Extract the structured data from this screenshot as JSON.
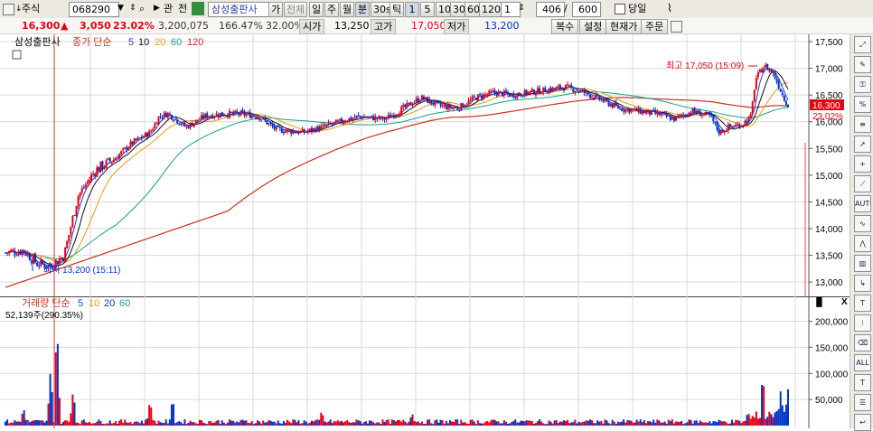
{
  "toolbar": {
    "market_type": "주식",
    "code": "068290",
    "related_label": "관",
    "prev_label": "전",
    "stock_name": "삼성출판사",
    "ga_label": "가",
    "all_label": "전체",
    "periods": [
      "일",
      "주",
      "월",
      "분",
      "30s",
      "틱"
    ],
    "intervals": [
      "1",
      "5",
      "10",
      "30",
      "60",
      "120"
    ],
    "multiplier": "1",
    "count": "406",
    "total": "600",
    "today_label": "당일"
  },
  "quote": {
    "price": "16,300",
    "change_arrow": "▲",
    "change": "3,050",
    "change_pct": "23.02%",
    "volume": "3,200,075",
    "volume_ratio": "166.47%",
    "turnover": "32.00%",
    "open_label": "시가",
    "open": "13,250",
    "high_label": "고가",
    "high": "17,050",
    "low_label": "저가",
    "low": "13,200",
    "buttons": [
      "복수",
      "설정",
      "현재가",
      "주문"
    ]
  },
  "price_panel": {
    "stock_name": "삼성출판사",
    "legend_label": "종가 단순",
    "ma_periods": [
      "5",
      "10",
      "20",
      "60",
      "120"
    ],
    "high_annotation": "최고 17,050 (15:09)",
    "low_annotation": "최저 13,200 (15:11)",
    "last_price_tag": "16,300",
    "last_pct_tag": "23.02%",
    "y_ticks": [
      "17,500",
      "17,000",
      "16,500",
      "16,000",
      "15,500",
      "15,000",
      "14,500",
      "14,000",
      "13,500",
      "13,000"
    ]
  },
  "volume_panel": {
    "legend_label": "거래량 단순",
    "ma_periods": [
      "5",
      "10",
      "20",
      "60"
    ],
    "current": "52,139주(290.35%)",
    "y_ticks": [
      "200,000",
      "150,000",
      "100,000",
      "50,000"
    ]
  },
  "colors": {
    "up": "#e60012",
    "down": "#0033cc",
    "ma5": "#1f3fd7",
    "ma10": "#111111",
    "ma20": "#e89a16",
    "ma60": "#17a087",
    "ma120": "#c8321e"
  },
  "chart_data": {
    "type": "line",
    "title": "",
    "series_kind": "candlestick_close",
    "ylim": [
      12800,
      17500
    ],
    "key_points": [
      {
        "x": 1,
        "close": 13550
      },
      {
        "x": 20,
        "close": 13600
      },
      {
        "x": 35,
        "close": 13350
      },
      {
        "x": 50,
        "close": 13300
      },
      {
        "x": 65,
        "close": 13500
      },
      {
        "x": 80,
        "close": 14600
      },
      {
        "x": 100,
        "close": 15100
      },
      {
        "x": 120,
        "close": 15300
      },
      {
        "x": 140,
        "close": 15600
      },
      {
        "x": 160,
        "close": 15800
      },
      {
        "x": 170,
        "close": 16100
      },
      {
        "x": 180,
        "close": 16150
      },
      {
        "x": 200,
        "close": 15900
      },
      {
        "x": 220,
        "close": 16100
      },
      {
        "x": 240,
        "close": 16150
      },
      {
        "x": 260,
        "close": 16150
      },
      {
        "x": 280,
        "close": 16100
      },
      {
        "x": 300,
        "close": 15850
      },
      {
        "x": 330,
        "close": 15800
      },
      {
        "x": 360,
        "close": 15950
      },
      {
        "x": 390,
        "close": 16100
      },
      {
        "x": 420,
        "close": 16050
      },
      {
        "x": 445,
        "close": 16300
      },
      {
        "x": 460,
        "close": 16450
      },
      {
        "x": 480,
        "close": 16300
      },
      {
        "x": 500,
        "close": 16250
      },
      {
        "x": 520,
        "close": 16450
      },
      {
        "x": 540,
        "close": 16550
      },
      {
        "x": 560,
        "close": 16500
      },
      {
        "x": 580,
        "close": 16550
      },
      {
        "x": 600,
        "close": 16600
      },
      {
        "x": 620,
        "close": 16650
      },
      {
        "x": 640,
        "close": 16550
      },
      {
        "x": 660,
        "close": 16400
      },
      {
        "x": 680,
        "close": 16250
      },
      {
        "x": 700,
        "close": 16200
      },
      {
        "x": 720,
        "close": 16150
      },
      {
        "x": 740,
        "close": 16050
      },
      {
        "x": 760,
        "close": 16200
      },
      {
        "x": 780,
        "close": 16100
      },
      {
        "x": 790,
        "close": 15800
      },
      {
        "x": 800,
        "close": 15900
      },
      {
        "x": 815,
        "close": 15950
      },
      {
        "x": 825,
        "close": 16100
      },
      {
        "x": 830,
        "close": 16800
      },
      {
        "x": 840,
        "close": 17050
      },
      {
        "x": 850,
        "close": 16900
      },
      {
        "x": 860,
        "close": 16500
      },
      {
        "x": 866,
        "close": 16300
      }
    ],
    "volume_key_points": [
      {
        "x": 20,
        "v": 35000
      },
      {
        "x": 50,
        "v": 110000
      },
      {
        "x": 57,
        "v": 200000
      },
      {
        "x": 75,
        "v": 70000
      },
      {
        "x": 160,
        "v": 50000
      },
      {
        "x": 185,
        "v": 55000
      },
      {
        "x": 350,
        "v": 30000
      },
      {
        "x": 450,
        "v": 25000
      },
      {
        "x": 838,
        "v": 97000
      },
      {
        "x": 858,
        "v": 45000
      },
      {
        "x": 866,
        "v": 52139
      }
    ]
  }
}
